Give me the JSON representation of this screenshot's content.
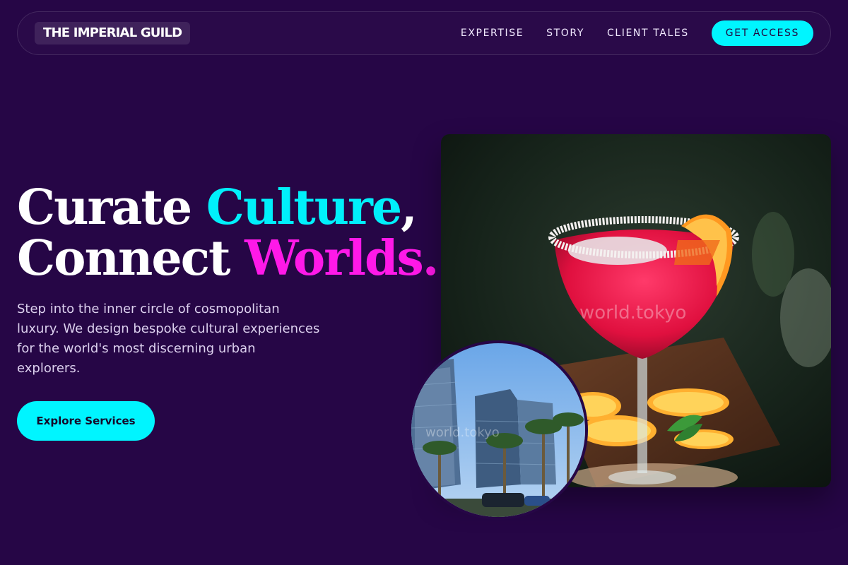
{
  "brand": {
    "logo_text": "THE IMPERIAL GUILD"
  },
  "nav": {
    "links": [
      "EXPERTISE",
      "STORY",
      "CLIENT TALES"
    ],
    "cta_label": "GET ACCESS"
  },
  "hero": {
    "title_line1_a": "Curate ",
    "title_line1_b": "Culture",
    "title_line1_c": ",",
    "title_line2_a": "Connect ",
    "title_line2_b": "Worlds.",
    "description": "Step into the inner circle of cosmopolitan luxury. We design bespoke cultural experiences for the world's most discerning urban explorers.",
    "cta_label": "Explore Services"
  },
  "images": {
    "main_watermark": "world.tokyo",
    "round_watermark": "world.tokyo"
  },
  "colors": {
    "background": "#260646",
    "accent_cyan": "#00f5ff",
    "accent_magenta": "#ff19e8"
  }
}
